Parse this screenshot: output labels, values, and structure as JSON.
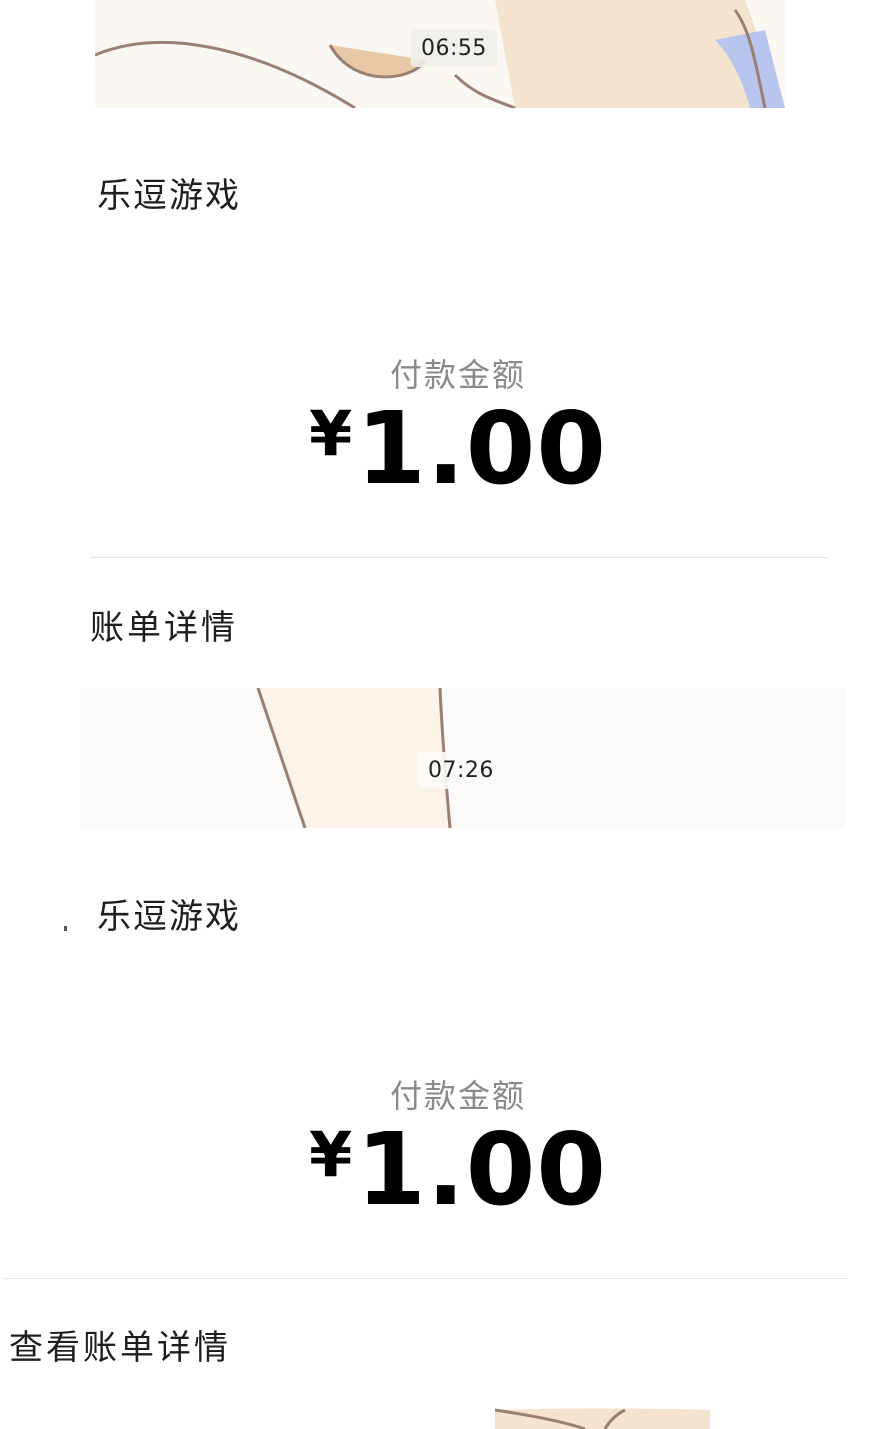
{
  "messages": [
    {
      "timestamp": "06:55",
      "merchant": "乐逗游戏",
      "amount_label": "付款金额",
      "currency_symbol": "¥",
      "amount_value": "1.00",
      "detail_link": "账单详情"
    },
    {
      "timestamp": "07:26",
      "merchant": "乐逗游戏",
      "amount_label": "付款金额",
      "currency_symbol": "¥",
      "amount_value": "1.00",
      "detail_link": "查看账单详情"
    }
  ],
  "colors": {
    "background": "#ffffff",
    "amount_label": "#8a8a8a",
    "amount": "#000000",
    "divider": "#e4e4e4",
    "wallpaper_skin": "#f4e3cf",
    "wallpaper_line": "#9a7f73",
    "wallpaper_blue": "#b8c5ee"
  },
  "icons": [
    "wallpaper-illustration"
  ]
}
